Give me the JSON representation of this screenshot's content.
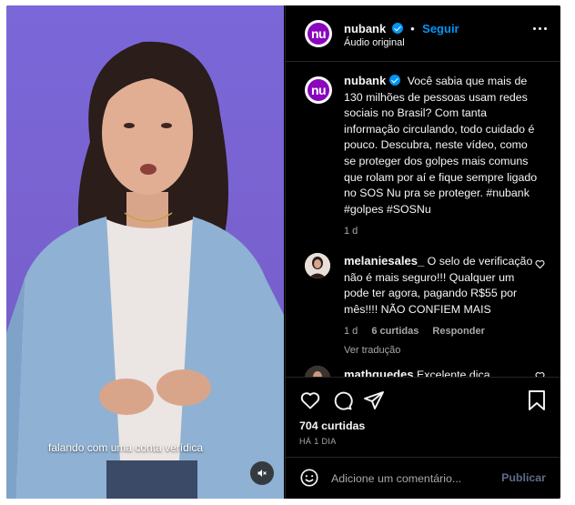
{
  "video": {
    "caption": "falando com uma conta verídica"
  },
  "header": {
    "username": "nubank",
    "separator": "•",
    "follow_label": "Seguir",
    "audio_label": "Áudio original",
    "avatar_text": "nu"
  },
  "post": {
    "username": "nubank",
    "caption": "Você sabia que mais de 130 milhões de pessoas usam redes sociais no Brasil? Com tanta informação circulando, todo cuidado é pouco. Descubra, neste vídeo, como se proteger dos golpes mais comuns que rolam por aí e fique sempre ligado no SOS Nu pra se proteger. #nubank #golpes #SOSNu",
    "time": "1 d"
  },
  "comments": [
    {
      "username": "melaniesales_",
      "text": "O selo de verificação não é mais seguro!!! Qualquer um pode ter agora, pagando R$55 por mês!!!! NÃO CONFIEM MAIS",
      "time": "1 d",
      "likes": "6 curtidas",
      "reply_label": "Responder",
      "translate_label": "Ver tradução"
    },
    {
      "username": "mathguedes",
      "text": "Excelente dica,"
    }
  ],
  "actions": {
    "likes": "704 curtidas",
    "date": "HÁ 1 DIA"
  },
  "comment_bar": {
    "placeholder": "Adicione um comentário...",
    "publish_label": "Publicar"
  },
  "colors": {
    "accent": "#0095f6",
    "brand": "#8a05be",
    "background": "#000000",
    "video_bg": "#7a63d1"
  }
}
